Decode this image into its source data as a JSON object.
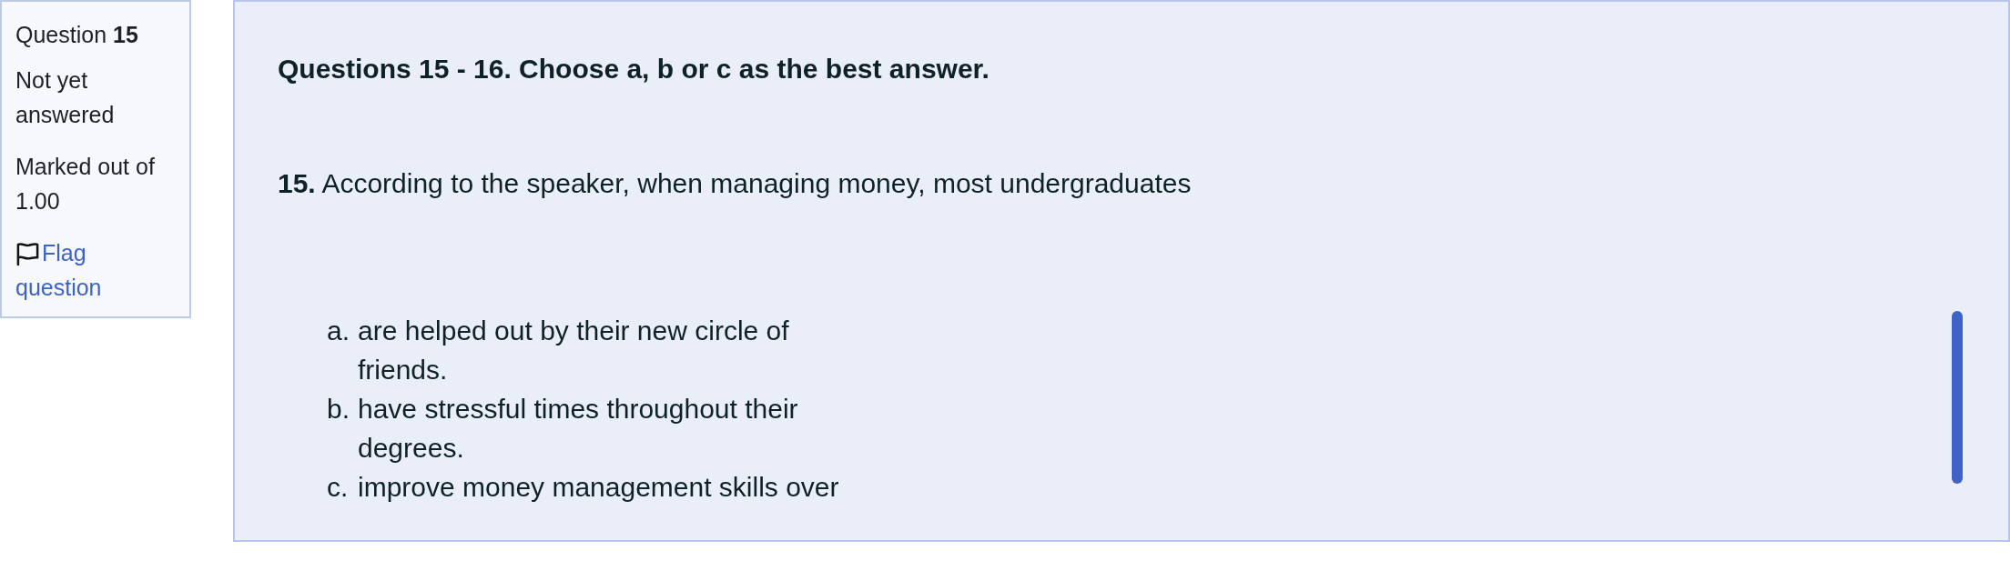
{
  "question_info": {
    "title": "Question **15**",
    "status": "Not yet answered",
    "marks": "Marked out of 1.00",
    "flag_link": "Flag question",
    "flagged": false
  },
  "question": {
    "instruction": "Questions 15 - 16. Choose a, b or c as the best answer.",
    "prompt": "**15.** According to the speaker, when managing money, most undergraduates",
    "options": [
      {
        "letter": "a.",
        "text": "are helped out by their new circle of friends."
      },
      {
        "letter": "b.",
        "text": "have stressful times throughout their degrees."
      },
      {
        "letter": "c.",
        "text": "improve money management skills over"
      }
    ]
  }
}
